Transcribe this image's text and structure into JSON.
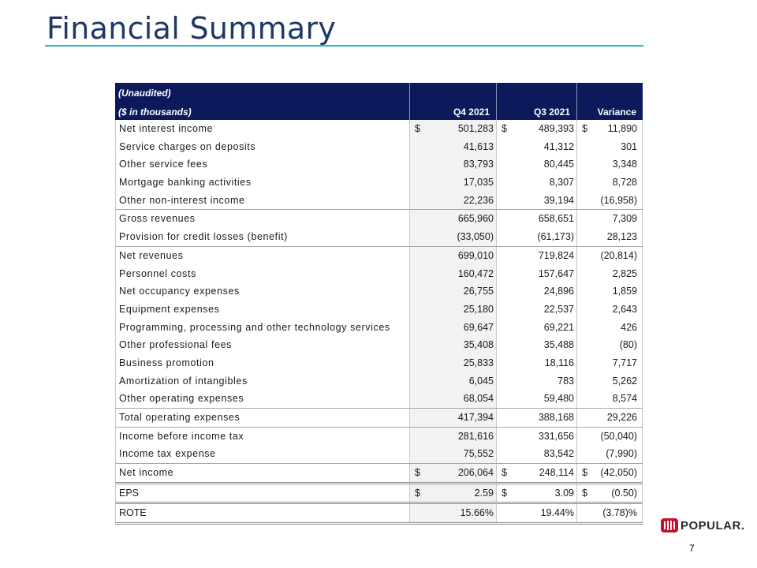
{
  "page": {
    "title": "Financial Summary",
    "page_number": "7",
    "logo_text": "POPULAR."
  },
  "table": {
    "header": {
      "unaudited": "(Unaudited)",
      "units": "($ in thousands)",
      "col_q4": "Q4 2021",
      "col_q3": "Q3 2021",
      "col_var": "Variance"
    },
    "rows": [
      {
        "label": "Net interest income",
        "q4": "501,283",
        "q3": "489,393",
        "var": "11,890",
        "dollar_q4": "$",
        "dollar_q3": "$",
        "dollar_var": "$"
      },
      {
        "label": "Service charges on deposits",
        "q4": "41,613",
        "q3": "41,312",
        "var": "301"
      },
      {
        "label": "Other service fees",
        "q4": "83,793",
        "q3": "80,445",
        "var": "3,348"
      },
      {
        "label": "Mortgage banking activities",
        "q4": "17,035",
        "q3": "8,307",
        "var": "8,728"
      },
      {
        "label": "Other non-interest income",
        "q4": "22,236",
        "q3": "39,194",
        "var": "(16,958)"
      },
      {
        "label": "Gross revenues",
        "q4": "665,960",
        "q3": "658,651",
        "var": "7,309"
      },
      {
        "label": "Provision for credit losses (benefit)",
        "q4": "(33,050)",
        "q3": "(61,173)",
        "var": "28,123"
      },
      {
        "label": "Net revenues",
        "q4": "699,010",
        "q3": "719,824",
        "var": "(20,814)"
      },
      {
        "label": "Personnel costs",
        "q4": "160,472",
        "q3": "157,647",
        "var": "2,825"
      },
      {
        "label": "Net occupancy expenses",
        "q4": "26,755",
        "q3": "24,896",
        "var": "1,859"
      },
      {
        "label": "Equipment expenses",
        "q4": "25,180",
        "q3": "22,537",
        "var": "2,643"
      },
      {
        "label": "Programming, processing and other technology services",
        "q4": "69,647",
        "q3": "69,221",
        "var": "426"
      },
      {
        "label": "Other professional fees",
        "q4": "35,408",
        "q3": "35,488",
        "var": "(80)"
      },
      {
        "label": "Business promotion",
        "q4": "25,833",
        "q3": "18,116",
        "var": "7,717"
      },
      {
        "label": "Amortization of intangibles",
        "q4": "6,045",
        "q3": "783",
        "var": "5,262"
      },
      {
        "label": "Other operating expenses",
        "q4": "68,054",
        "q3": "59,480",
        "var": "8,574"
      },
      {
        "label": "Total operating expenses",
        "q4": "417,394",
        "q3": "388,168",
        "var": "29,226"
      },
      {
        "label": "Income before income tax",
        "q4": "281,616",
        "q3": "331,656",
        "var": "(50,040)"
      },
      {
        "label": "Income tax expense",
        "q4": "75,552",
        "q3": "83,542",
        "var": "(7,990)"
      },
      {
        "label": "Net income",
        "q4": "206,064",
        "q3": "248,114",
        "var": "(42,050)",
        "dollar_q4": "$",
        "dollar_q3": "$",
        "dollar_var": "$"
      },
      {
        "label": "EPS",
        "q4": "2.59",
        "q3": "3.09",
        "var": "(0.50)",
        "dollar_q4": "$",
        "dollar_q3": "$",
        "dollar_var": "$"
      },
      {
        "label": "ROTE",
        "q4": "15.66%",
        "q3": "19.44%",
        "var": "(3.78)%"
      }
    ]
  },
  "colors": {
    "title": "#1f3864",
    "title_rule": "#2eb6c8",
    "header_bg": "#0c1a5c",
    "logo_red": "#c8102e"
  }
}
